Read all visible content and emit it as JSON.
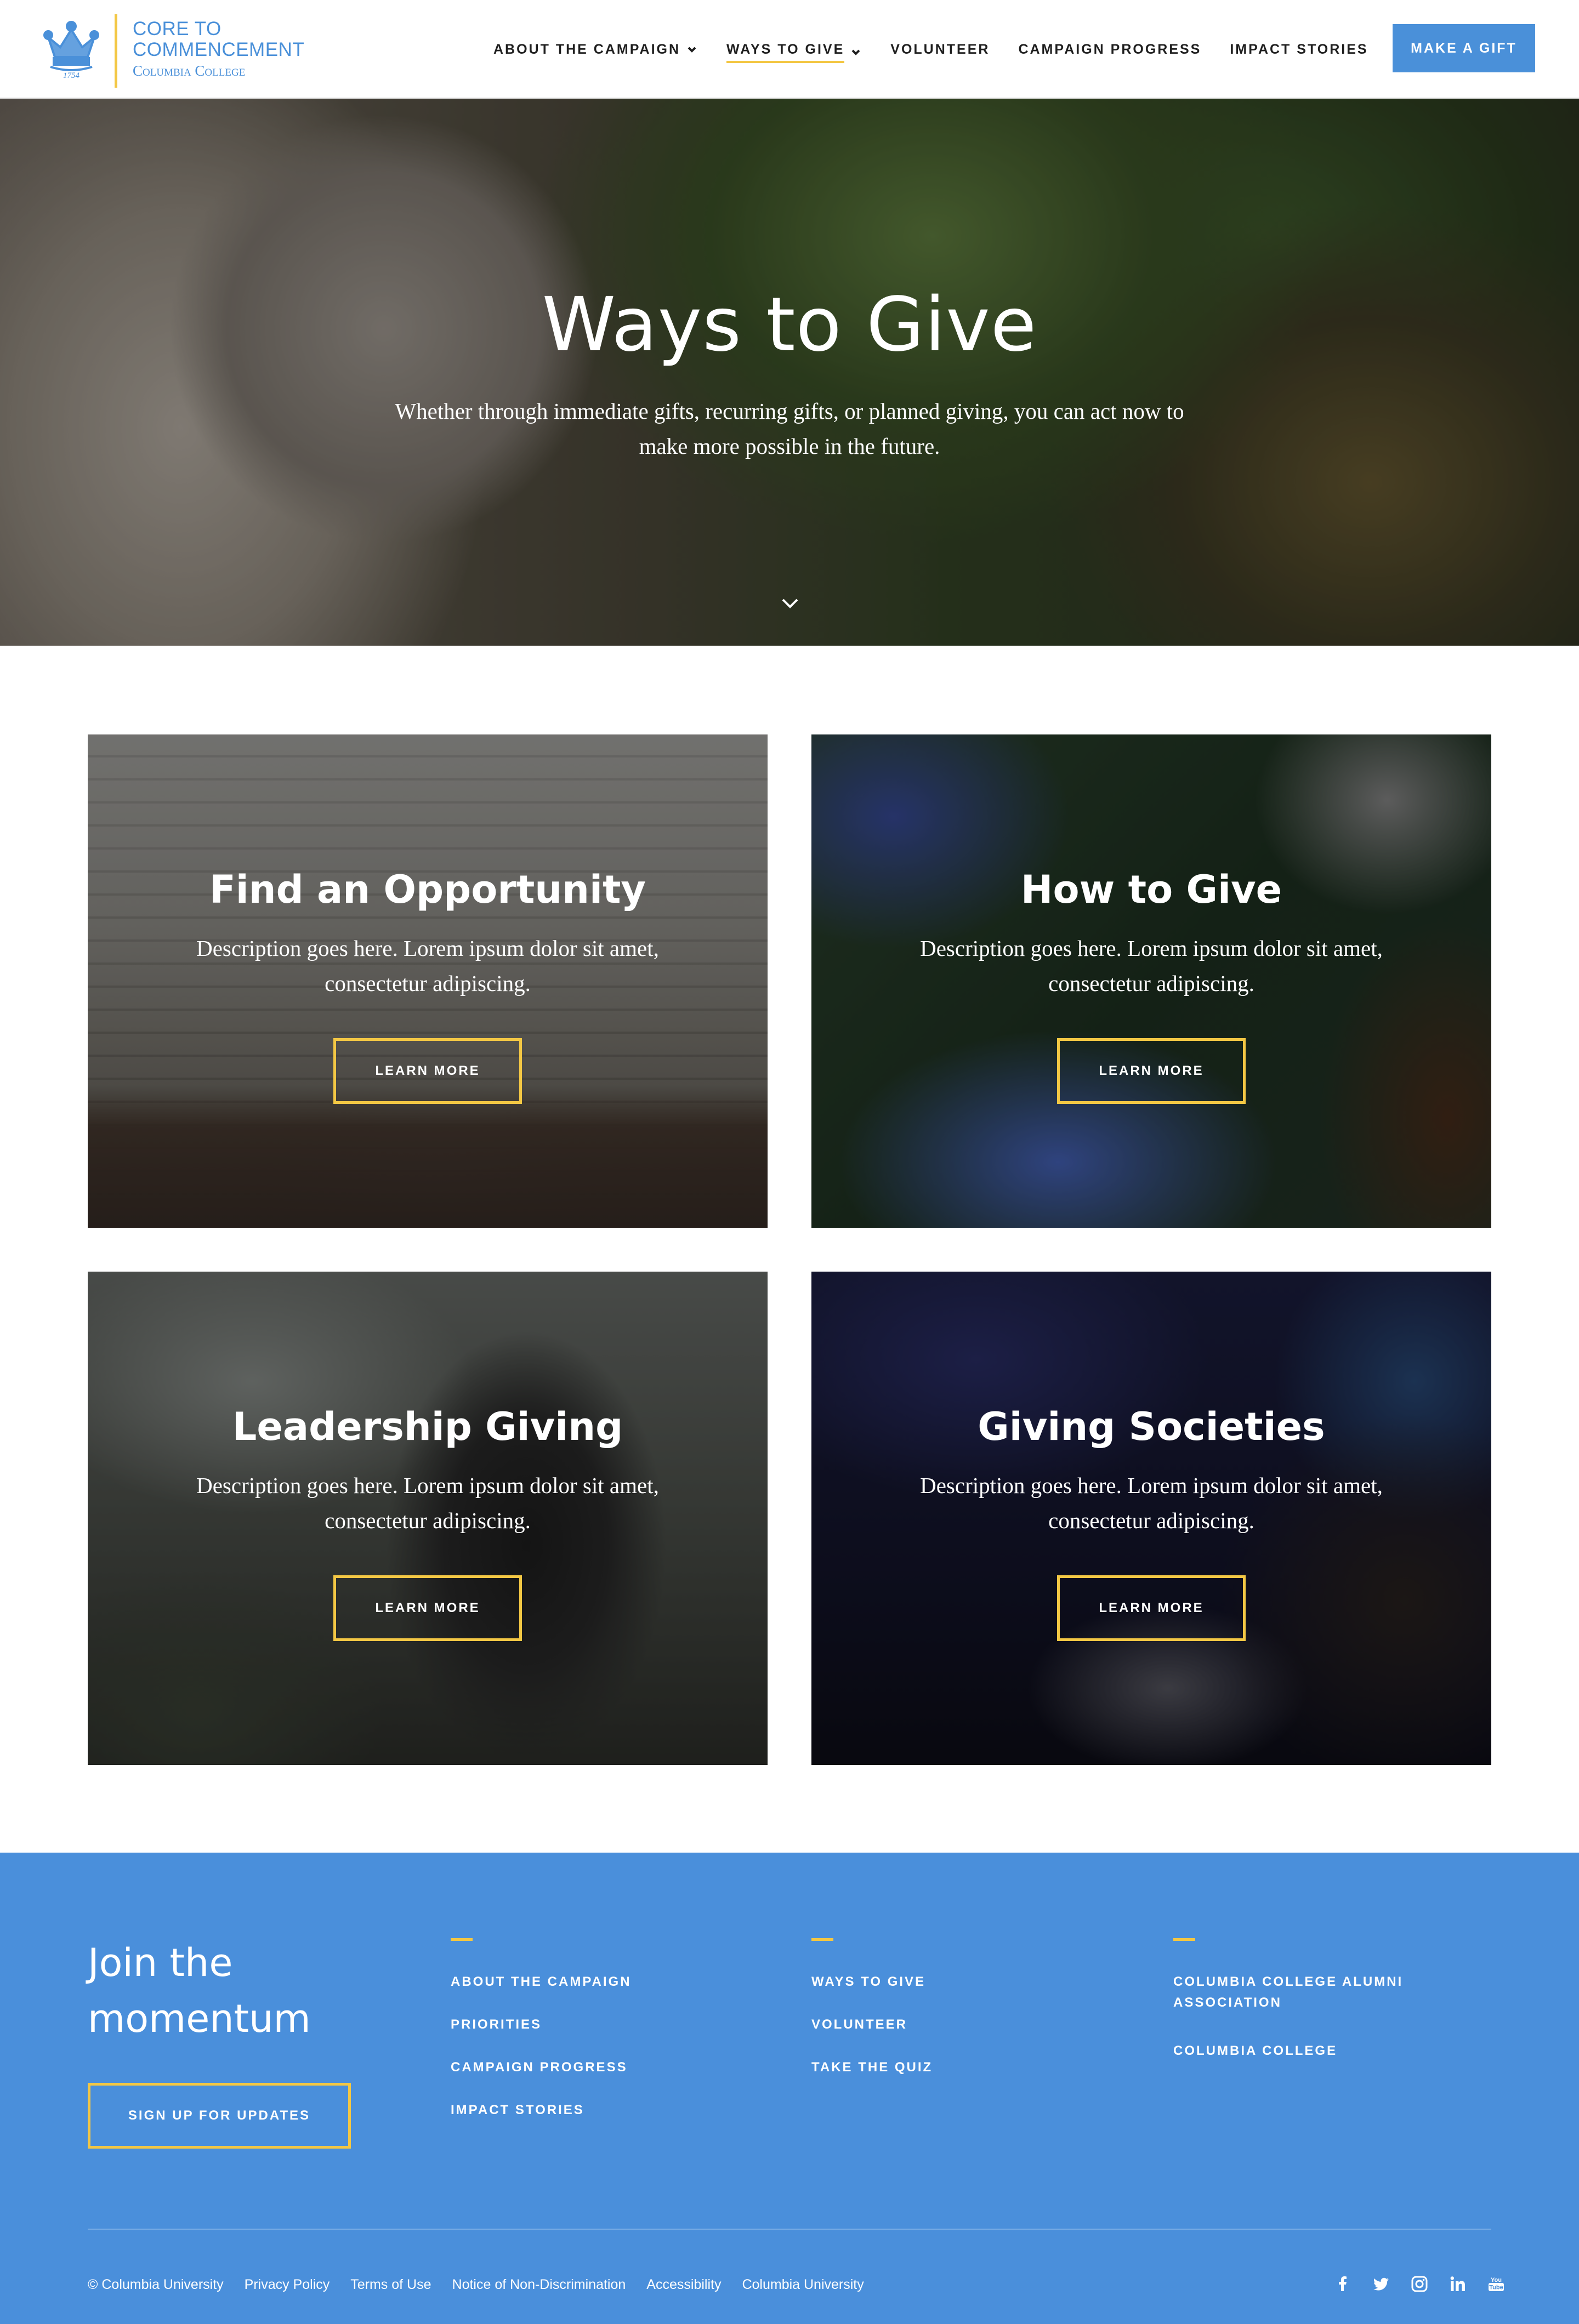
{
  "colors": {
    "brand_blue": "#4a90d9",
    "accent_gold": "#f3c744",
    "footer_blue": "#4a8fdb"
  },
  "header": {
    "logo": {
      "line1": "CORE TO",
      "line2": "COMMENCEMENT",
      "line3": "Columbia College",
      "icon": "crown-icon",
      "year": "1754"
    },
    "nav": [
      {
        "label": "ABOUT THE CAMPAIGN",
        "dropdown": true
      },
      {
        "label": "WAYS TO GIVE",
        "dropdown": true,
        "active": true
      },
      {
        "label": "VOLUNTEER",
        "dropdown": false
      },
      {
        "label": "CAMPAIGN PROGRESS",
        "dropdown": false
      },
      {
        "label": "IMPACT STORIES",
        "dropdown": false
      }
    ],
    "search_icon": "search-icon",
    "gift_button": "MAKE A GIFT"
  },
  "hero": {
    "title": "Ways to Give",
    "subtitle": "Whether through immediate gifts, recurring gifts, or planned giving, you can act now to make more possible in the future.",
    "scroll_icon": "chevron-down-icon"
  },
  "cards": [
    {
      "title": "Find an Opportunity",
      "description": "Description goes here. Lorem ipsum dolor sit amet, consectetur adipiscing.",
      "button": "LEARN MORE"
    },
    {
      "title": "How to Give",
      "description": "Description goes here. Lorem ipsum dolor sit amet, consectetur adipiscing.",
      "button": "LEARN MORE"
    },
    {
      "title": "Leadership Giving",
      "description": "Description goes here. Lorem ipsum dolor sit amet, consectetur adipiscing.",
      "button": "LEARN MORE"
    },
    {
      "title": "Giving Societies",
      "description": "Description goes here. Lorem ipsum dolor sit amet, consectetur adipiscing.",
      "button": "LEARN MORE"
    }
  ],
  "footer": {
    "join_title": "Join the momentum",
    "signup_button": "SIGN UP FOR UPDATES",
    "columns": [
      [
        "ABOUT THE CAMPAIGN",
        "PRIORITIES",
        "CAMPAIGN PROGRESS",
        "IMPACT STORIES"
      ],
      [
        "WAYS TO GIVE",
        "VOLUNTEER",
        "TAKE THE QUIZ"
      ],
      [
        "COLUMBIA COLLEGE ALUMNI ASSOCIATION",
        "COLUMBIA COLLEGE"
      ]
    ],
    "copyright": "© Columbia University",
    "legal_links": [
      "Privacy Policy",
      "Terms of Use",
      "Notice of Non-Discrimination",
      "Accessibility",
      "Columbia University"
    ],
    "social": [
      "facebook-icon",
      "twitter-icon",
      "instagram-icon",
      "linkedin-icon",
      "youtube-icon"
    ]
  }
}
